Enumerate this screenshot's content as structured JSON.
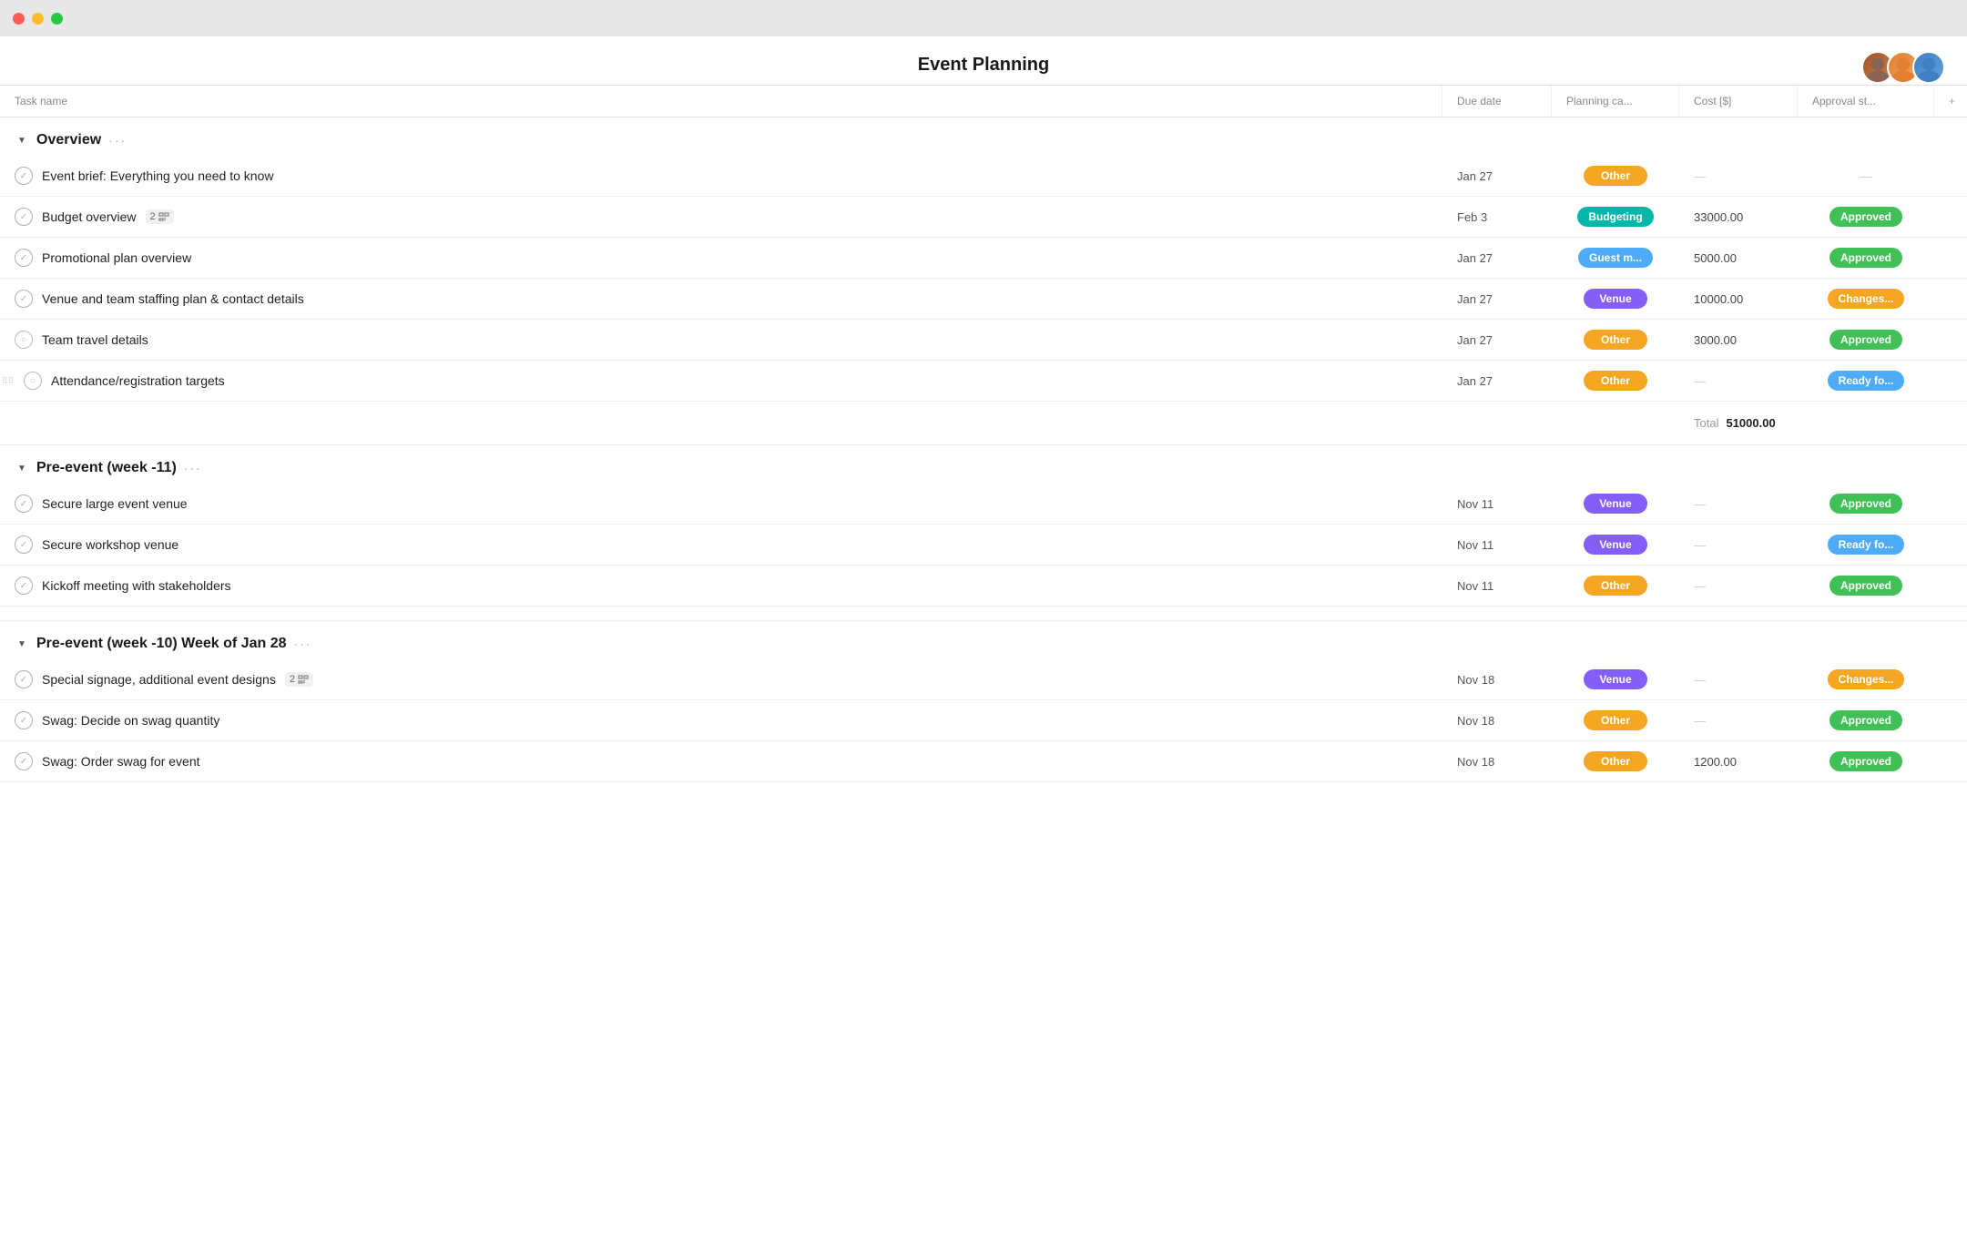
{
  "titleBar": {
    "trafficLights": [
      "red",
      "yellow",
      "green"
    ]
  },
  "header": {
    "title": "Event Planning"
  },
  "avatars": [
    {
      "id": "av1",
      "label": "User 1"
    },
    {
      "id": "av2",
      "label": "User 2"
    },
    {
      "id": "av3",
      "label": "User 3"
    }
  ],
  "columns": [
    {
      "id": "task-name",
      "label": "Task name"
    },
    {
      "id": "due-date",
      "label": "Due date"
    },
    {
      "id": "planning-cat",
      "label": "Planning ca..."
    },
    {
      "id": "cost",
      "label": "Cost [$]"
    },
    {
      "id": "approval-st",
      "label": "Approval st..."
    },
    {
      "id": "add-col",
      "label": "+"
    }
  ],
  "sections": [
    {
      "id": "overview",
      "title": "Overview",
      "dots": "···",
      "rows": [
        {
          "id": "row-1",
          "task": "Event brief: Everything you need to know",
          "subtasks": null,
          "dueDate": "Jan 27",
          "planningCat": "Other",
          "planningColor": "badge-orange",
          "cost": "—",
          "approvalStatus": "—",
          "approvalColor": null
        },
        {
          "id": "row-2",
          "task": "Budget overview",
          "subtasks": "2",
          "dueDate": "Feb 3",
          "planningCat": "Budgeting",
          "planningColor": "badge-teal",
          "cost": "33000.00",
          "approvalStatus": "Approved",
          "approvalColor": "badge-green"
        },
        {
          "id": "row-3",
          "task": "Promotional plan overview",
          "subtasks": null,
          "dueDate": "Jan 27",
          "planningCat": "Guest m...",
          "planningColor": "badge-blue",
          "cost": "5000.00",
          "approvalStatus": "Approved",
          "approvalColor": "badge-green"
        },
        {
          "id": "row-4",
          "task": "Venue and team staffing plan & contact details",
          "subtasks": null,
          "dueDate": "Jan 27",
          "planningCat": "Venue",
          "planningColor": "badge-purple",
          "cost": "10000.00",
          "approvalStatus": "Changes...",
          "approvalColor": "badge-changes"
        },
        {
          "id": "row-5",
          "task": "Team travel details",
          "subtasks": null,
          "dueDate": "Jan 27",
          "planningCat": "Other",
          "planningColor": "badge-orange",
          "cost": "3000.00",
          "approvalStatus": "Approved",
          "approvalColor": "badge-green"
        },
        {
          "id": "row-6",
          "task": "Attendance/registration targets",
          "subtasks": null,
          "dueDate": "Jan 27",
          "planningCat": "Other",
          "planningColor": "badge-orange",
          "cost": "—",
          "approvalStatus": "Ready fo...",
          "approvalColor": "badge-ready"
        }
      ],
      "total": {
        "label": "Total",
        "value": "51000.00"
      }
    },
    {
      "id": "pre-event-11",
      "title": "Pre-event (week -11)",
      "dots": "···",
      "rows": [
        {
          "id": "row-7",
          "task": "Secure large event venue",
          "subtasks": null,
          "dueDate": "Nov 11",
          "planningCat": "Venue",
          "planningColor": "badge-purple",
          "cost": "—",
          "approvalStatus": "Approved",
          "approvalColor": "badge-green"
        },
        {
          "id": "row-8",
          "task": "Secure workshop venue",
          "subtasks": null,
          "dueDate": "Nov 11",
          "planningCat": "Venue",
          "planningColor": "badge-purple",
          "cost": "—",
          "approvalStatus": "Ready fo...",
          "approvalColor": "badge-ready"
        },
        {
          "id": "row-9",
          "task": "Kickoff meeting with stakeholders",
          "subtasks": null,
          "dueDate": "Nov 11",
          "planningCat": "Other",
          "planningColor": "badge-orange",
          "cost": "—",
          "approvalStatus": "Approved",
          "approvalColor": "badge-green"
        }
      ],
      "total": null
    },
    {
      "id": "pre-event-10",
      "title": "Pre-event (week -10)  Week of Jan 28",
      "dots": "···",
      "rows": [
        {
          "id": "row-10",
          "task": "Special signage, additional event designs",
          "subtasks": "2",
          "dueDate": "Nov 18",
          "planningCat": "Venue",
          "planningColor": "badge-purple",
          "cost": "—",
          "approvalStatus": "Changes...",
          "approvalColor": "badge-changes"
        },
        {
          "id": "row-11",
          "task": "Swag: Decide on swag quantity",
          "subtasks": null,
          "dueDate": "Nov 18",
          "planningCat": "Other",
          "planningColor": "badge-orange",
          "cost": "—",
          "approvalStatus": "Approved",
          "approvalColor": "badge-green"
        },
        {
          "id": "row-12",
          "task": "Swag: Order swag for event",
          "subtasks": null,
          "dueDate": "Nov 18",
          "planningCat": "Other",
          "planningColor": "badge-orange",
          "cost": "1200.00",
          "approvalStatus": "Approved",
          "approvalColor": "badge-green"
        }
      ],
      "total": null
    }
  ]
}
